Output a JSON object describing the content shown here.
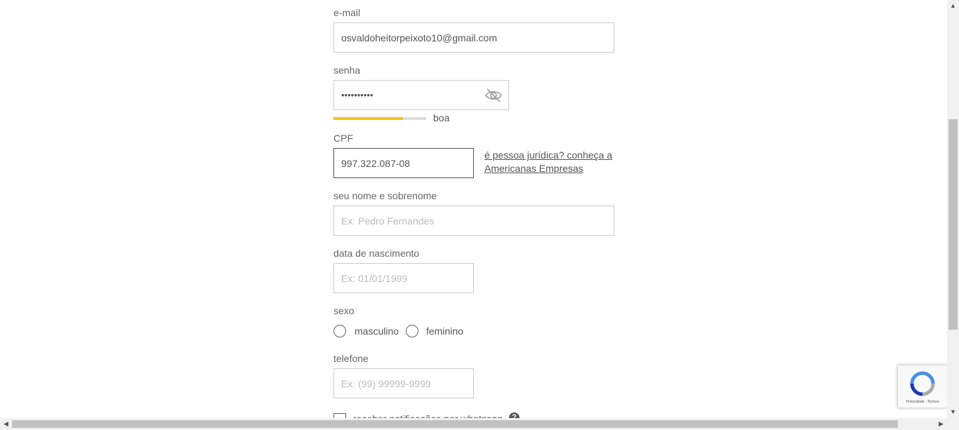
{
  "email": {
    "label": "e-mail",
    "value": "osvaldoheitorpeixoto10@gmail.com"
  },
  "password": {
    "label": "senha",
    "value": "••••••••••",
    "toggle_icon": "eye-slash-icon"
  },
  "strength": {
    "label": "boa",
    "level": 0.75,
    "color": "#f5c518"
  },
  "cpf": {
    "label": "CPF",
    "value": "997.322.087-08"
  },
  "pj_link": {
    "line1": "é pessoa jurídica? conheça a",
    "line2": "Americanas Empresas"
  },
  "name": {
    "label": "seu nome e sobrenome",
    "placeholder": "Ex: Pedro Fernandes"
  },
  "birth": {
    "label": "data de nascimento",
    "placeholder": "Ex: 01/01/1999"
  },
  "sex": {
    "label": "sexo",
    "options": [
      "masculino",
      "feminino"
    ]
  },
  "phone": {
    "label": "telefone",
    "placeholder": "Ex: (99) 99999-9999"
  },
  "whatsapp": {
    "label": "receber notificações por whatsapp",
    "help": "?"
  },
  "recaptcha": {
    "text": "Privacidade - Termos"
  }
}
